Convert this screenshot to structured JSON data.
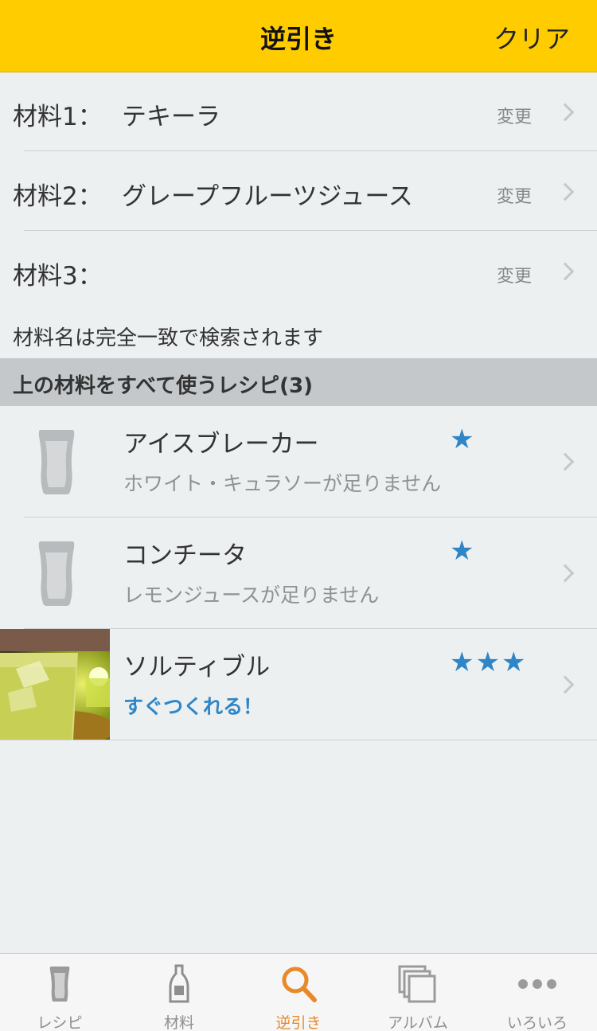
{
  "header": {
    "title": "逆引き",
    "clear_label": "クリア"
  },
  "ingredients": [
    {
      "label": "材料1：",
      "value": "テキーラ",
      "change_label": "変更"
    },
    {
      "label": "材料2：",
      "value": "グレープフルーツジュース",
      "change_label": "変更"
    },
    {
      "label": "材料3：",
      "value": "",
      "change_label": "変更"
    }
  ],
  "note": "材料名は完全一致で検索されます",
  "section_title": "上の材料をすべて使うレシピ(3)",
  "recipes": [
    {
      "name": "アイスブレーカー",
      "stars": "★",
      "status": "ホワイト・キュラソーが足りません",
      "image": "glass-icon"
    },
    {
      "name": "コンチータ",
      "stars": "★",
      "status": "レモンジュースが足りません",
      "image": "glass-icon"
    },
    {
      "name": "ソルティブル",
      "stars": "★★★",
      "status": "すぐつくれる！",
      "image": "photo"
    }
  ],
  "tabs": [
    {
      "label": "レシピ",
      "icon": "glass-icon",
      "active": false
    },
    {
      "label": "材料",
      "icon": "bottle-icon",
      "active": false
    },
    {
      "label": "逆引き",
      "icon": "search-icon",
      "active": true
    },
    {
      "label": "アルバム",
      "icon": "album-icon",
      "active": false
    },
    {
      "label": "いろいろ",
      "icon": "more-icon",
      "active": false
    }
  ],
  "colors": {
    "header": "#ffcc00",
    "accent_blue": "#2f86c6",
    "active_tab": "#e8892b",
    "background": "#edf0f1"
  }
}
